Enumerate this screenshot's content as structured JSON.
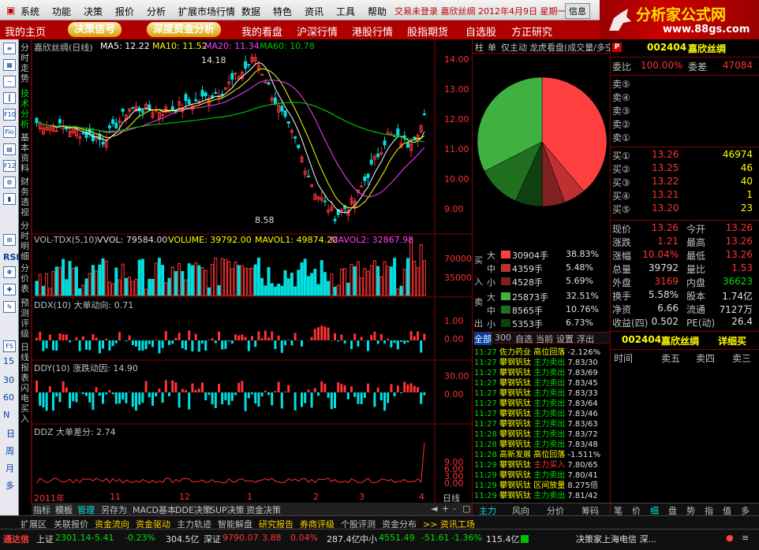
{
  "menu": {
    "items": [
      "系统",
      "功能",
      "决策",
      "报价",
      "分析",
      "扩展市场行情",
      "数据",
      "特色",
      "资讯",
      "工具",
      "帮助"
    ],
    "status": "交易未登录 嘉欣丝绸 2012年4月9日 星期一",
    "info_btn": "信息"
  },
  "logo": {
    "text": "分析家公式网",
    "url": "www.88gs.com"
  },
  "tabs": [
    "我的主页",
    "决策信号",
    "深度资金分析",
    "我的看盘",
    "沪深行情",
    "港股行情",
    "股指期货",
    "自选股",
    "方正研究"
  ],
  "left_tools": [
    "分时走势",
    "技术分析",
    "基本资料",
    "财务透视",
    "分时明细",
    "分价表",
    "预测评级",
    "日线报表",
    "闪电买入"
  ],
  "left_tool_nums": [
    "15",
    "30",
    "60",
    "N",
    "日",
    "周",
    "月",
    "多"
  ],
  "main": {
    "title": "嘉欣丝绸(日线)",
    "ma5": "MA5: 12.22",
    "ma10": "MA10: 11.52",
    "ma20": "MA20: 11.34",
    "ma60": "MA60: 10.78",
    "y_ticks": [
      "14.00",
      "13.00",
      "12.00",
      "11.00",
      "10.00",
      "9.00"
    ],
    "high_label": "14.18",
    "low_label": "8.58"
  },
  "vol": {
    "title": "VOL-TDX(5,10)",
    "vvol": "VVOL: 79584.00",
    "volume": "VOLUME: 39792.00",
    "mavol1": "MAVOL1: 49874.20",
    "mavol2": "MAVOL2: 32867.98",
    "ticks": [
      "70000",
      "35000"
    ]
  },
  "ddx": {
    "title": "DDX(10) 大单动向: 0.71",
    "ticks": [
      "1.00",
      "0.00"
    ]
  },
  "ddy": {
    "title": "DDY(10) 涨跌动因: 14.90",
    "ticks": [
      "30.00",
      "0.00"
    ]
  },
  "ddz": {
    "title": "DDZ 大单差分: 2.74",
    "ticks": [
      "9.00",
      "6.00",
      "3.00",
      "0.00"
    ]
  },
  "xaxis": {
    "labels": [
      "2011年",
      "11",
      "12",
      "1",
      "2",
      "3",
      "4"
    ],
    "right": "日线"
  },
  "bottom_tabs": [
    "指标",
    "模板",
    "管理",
    "另存为",
    "MACD基本",
    "DDE决策",
    "SUP决策",
    "资金决策"
  ],
  "right_tabs": [
    "柱",
    "单",
    "仅主动",
    "龙虎看盘(成交量/多空)"
  ],
  "pie": {
    "slices": [
      {
        "label": "买大",
        "pct": 38.83,
        "color": "#ff4040"
      },
      {
        "label": "买中",
        "pct": 5.48,
        "color": "#c03030"
      },
      {
        "label": "买小",
        "pct": 5.69,
        "color": "#802020"
      },
      {
        "label": "卖小",
        "pct": 6.73,
        "color": "#104010"
      },
      {
        "label": "卖中",
        "pct": 10.76,
        "color": "#207020"
      },
      {
        "label": "卖大",
        "pct": 32.51,
        "color": "#40b040"
      }
    ]
  },
  "flow": {
    "buy": [
      {
        "k": "大",
        "v": "30904手",
        "p": "38.83%"
      },
      {
        "k": "中",
        "v": "4359手",
        "p": "5.48%"
      },
      {
        "k": "小",
        "v": "4528手",
        "p": "5.69%"
      }
    ],
    "sell": [
      {
        "k": "大",
        "v": "25873手",
        "p": "32.51%"
      },
      {
        "k": "中",
        "v": "8565手",
        "p": "10.76%"
      },
      {
        "k": "小",
        "v": "5353手",
        "p": "6.73%"
      }
    ],
    "buy_side": "买入",
    "sell_side": "卖出"
  },
  "right_subtabs": [
    "全部",
    "300",
    "自选",
    "当前",
    "设置",
    "浮出"
  ],
  "trades": [
    {
      "t": "11:27",
      "n": "佐力药业",
      "a": "高位回落",
      "v": "-2.126%"
    },
    {
      "t": "11:27",
      "n": "攀钢钒钛",
      "a": "主力卖出",
      "v": "7.83/30"
    },
    {
      "t": "11:27",
      "n": "攀钢钒钛",
      "a": "主力卖出",
      "v": "7.83/69"
    },
    {
      "t": "11:27",
      "n": "攀钢钒钛",
      "a": "主力卖出",
      "v": "7.83/45"
    },
    {
      "t": "11:27",
      "n": "攀钢钒钛",
      "a": "主力卖出",
      "v": "7.83/33"
    },
    {
      "t": "11:27",
      "n": "攀钢钒钛",
      "a": "主力卖出",
      "v": "7.83/64"
    },
    {
      "t": "11:27",
      "n": "攀钢钒钛",
      "a": "主力卖出",
      "v": "7.83/46"
    },
    {
      "t": "11:27",
      "n": "攀钢钒钛",
      "a": "主力卖出",
      "v": "7.83/63"
    },
    {
      "t": "11:28",
      "n": "攀钢钒钛",
      "a": "主力卖出",
      "v": "7.83/72"
    },
    {
      "t": "11:28",
      "n": "攀钢钒钛",
      "a": "主力卖出",
      "v": "7.83/48"
    },
    {
      "t": "11:28",
      "n": "高新发展",
      "a": "高位回落",
      "v": "-1.511%"
    },
    {
      "t": "11:29",
      "n": "攀钢钒钛",
      "a": "主力买入",
      "v": "7.80/65"
    },
    {
      "t": "11:29",
      "n": "攀钢钒钛",
      "a": "主力卖出",
      "v": "7.80/41"
    },
    {
      "t": "11:29",
      "n": "攀钢钒钛",
      "a": "区间放量",
      "v": "8.275倍"
    },
    {
      "t": "11:29",
      "n": "攀钢钒钛",
      "a": "主力卖出",
      "v": "7.81/42"
    }
  ],
  "quote": {
    "code": "002404",
    "name": "嘉欣丝绸",
    "weibi_l": "委比",
    "weibi": "100.00%",
    "weicha_l": "委差",
    "weicha": "47084",
    "sells": [
      "卖⑤",
      "卖④",
      "卖③",
      "卖②",
      "卖①"
    ],
    "buys": [
      {
        "l": "买①",
        "p": "13.26",
        "v": "46974"
      },
      {
        "l": "买②",
        "p": "13.25",
        "v": "46"
      },
      {
        "l": "买③",
        "p": "13.22",
        "v": "40"
      },
      {
        "l": "买④",
        "p": "13.21",
        "v": "1"
      },
      {
        "l": "买⑤",
        "p": "13.20",
        "v": "23"
      }
    ],
    "stats": [
      {
        "l1": "现价",
        "v1": "13.26",
        "l2": "今开",
        "v2": "13.26"
      },
      {
        "l1": "涨跌",
        "v1": "1.21",
        "l2": "最高",
        "v2": "13.26"
      },
      {
        "l1": "涨幅",
        "v1": "10.04%",
        "l2": "最低",
        "v2": "13.26"
      },
      {
        "l1": "总量",
        "v1": "39792",
        "l2": "量比",
        "v2": "1.53"
      },
      {
        "l1": "外盘",
        "v1": "3169",
        "l2": "内盘",
        "v2": "36623"
      },
      {
        "l1": "换手",
        "v1": "5.58%",
        "l2": "股本",
        "v2": "1.74亿"
      },
      {
        "l1": "净资",
        "v1": "6.66",
        "l2": "流通",
        "v2": "7127万"
      },
      {
        "l1": "收益(四)",
        "v1": "0.502",
        "l2": "PE(动)",
        "v2": "26.4"
      }
    ],
    "detail_label": "详细买",
    "cols": [
      "时间",
      "卖五",
      "卖四",
      "卖三"
    ]
  },
  "right_bottom_tabs": [
    "主力",
    "风向",
    "分价",
    "筹码"
  ],
  "quote_bottom_tabs": [
    "笔",
    "价",
    "细",
    "盘",
    "势",
    "指",
    "值",
    "多"
  ],
  "funcbar": [
    "扩展区",
    "关联报价",
    "资金流向",
    "资金驱动",
    "主力轨迹",
    "智能解盘",
    "研究报告",
    "券商评级",
    "个股评测",
    "资金分布",
    ">> 资讯工场"
  ],
  "status": {
    "brand": "通达信",
    "sh": "上证",
    "sh_v": "2301.14",
    "sh_c": "-5.41",
    "sh_p": "-0.23%",
    "sh_a": "304.5亿",
    "sz": "深证",
    "sz_v": "9790.07",
    "sz_c": "3.88",
    "sz_p": "0.04%",
    "sz_a": "287.4亿",
    "zx": "中小",
    "zx_v": "4551.49",
    "zx_c": "-51.61",
    "zx_p": "-1.36%",
    "zx_a": "115.4亿",
    "right": "决策家上海电信 深..."
  },
  "colors": {
    "up": "#ff3333",
    "down": "#00e0e0",
    "ma5": "#ffffff",
    "ma10": "#ffff00",
    "ma20": "#ff40ff",
    "ma60": "#00c000"
  }
}
